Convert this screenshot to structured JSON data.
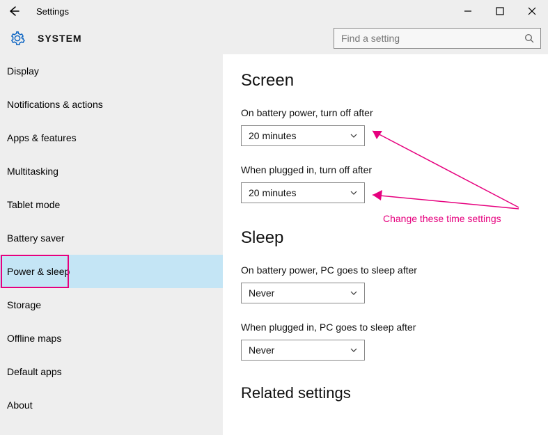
{
  "window": {
    "title": "Settings",
    "caption": "SYSTEM",
    "search_placeholder": "Find a setting"
  },
  "sidebar": {
    "items": [
      {
        "label": "Display"
      },
      {
        "label": "Notifications & actions"
      },
      {
        "label": "Apps & features"
      },
      {
        "label": "Multitasking"
      },
      {
        "label": "Tablet mode"
      },
      {
        "label": "Battery saver"
      },
      {
        "label": "Power & sleep"
      },
      {
        "label": "Storage"
      },
      {
        "label": "Offline maps"
      },
      {
        "label": "Default apps"
      },
      {
        "label": "About"
      }
    ],
    "selected_index": 6
  },
  "content": {
    "screen_heading": "Screen",
    "screen_battery_label": "On battery power, turn off after",
    "screen_battery_value": "20 minutes",
    "screen_plugged_label": "When plugged in, turn off after",
    "screen_plugged_value": "20 minutes",
    "sleep_heading": "Sleep",
    "sleep_battery_label": "On battery power, PC goes to sleep after",
    "sleep_battery_value": "Never",
    "sleep_plugged_label": "When plugged in, PC goes to sleep after",
    "sleep_plugged_value": "Never",
    "related_heading": "Related settings"
  },
  "annotation": {
    "text": "Change these time settings"
  }
}
